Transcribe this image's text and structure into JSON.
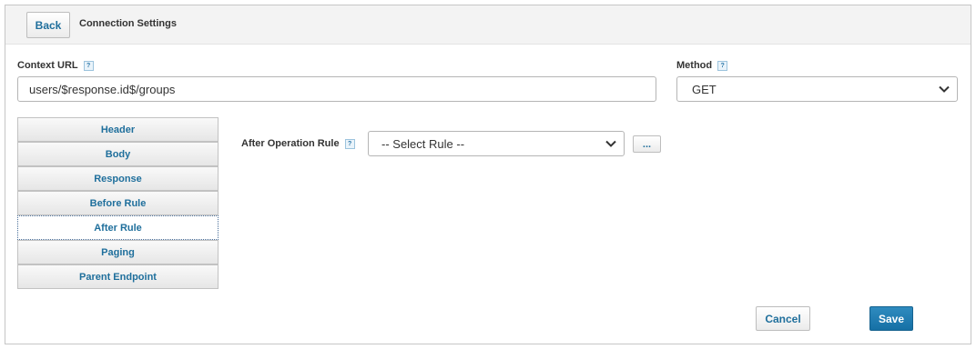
{
  "header": {
    "back_label": "Back",
    "title": "Connection Settings"
  },
  "context_url": {
    "label": "Context URL",
    "help": "?",
    "value": "users/$response.id$/groups"
  },
  "method": {
    "label": "Method",
    "help": "?",
    "selected": "GET"
  },
  "tabs": [
    {
      "label": "Header"
    },
    {
      "label": "Body"
    },
    {
      "label": "Response"
    },
    {
      "label": "Before Rule"
    },
    {
      "label": "After Rule",
      "active": true
    },
    {
      "label": "Paging"
    },
    {
      "label": "Parent Endpoint"
    }
  ],
  "after_rule": {
    "label": "After Operation Rule",
    "help": "?",
    "selected": "-- Select Rule --",
    "more_label": "..."
  },
  "footer": {
    "cancel_label": "Cancel",
    "save_label": "Save"
  },
  "colors": {
    "link_blue": "#1f6f9c",
    "primary": "#1670a5",
    "topbar_bg": "#f3f3f3"
  }
}
